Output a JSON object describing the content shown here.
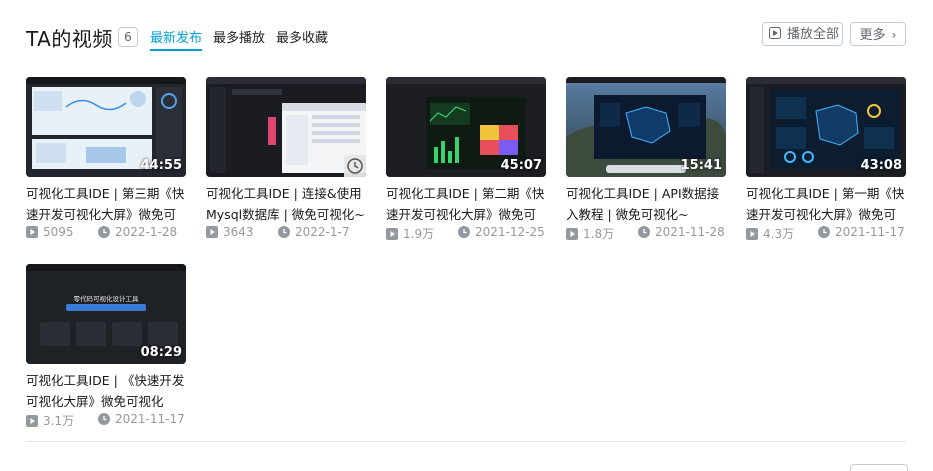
{
  "section": {
    "title": "TA的视频",
    "count": "6",
    "tabs": [
      {
        "label": "最新发布"
      },
      {
        "label": "最多播放"
      },
      {
        "label": "最多收藏"
      }
    ],
    "play_all_label": "播放全部",
    "more_label": "更多"
  },
  "videos": [
    {
      "title": "可视化工具IDE | 第三期《快速开发可视化大屏》微免可视",
      "duration": "44:55",
      "plays": "5095",
      "date": "2022-1-28"
    },
    {
      "title": "可视化工具IDE | 连接&使用Mysql数据库 | 微免可视化~",
      "duration": "",
      "plays": "3643",
      "date": "2022-1-7"
    },
    {
      "title": "可视化工具IDE | 第二期《快速开发可视化大屏》微免可视",
      "duration": "45:07",
      "plays": "1.9万",
      "date": "2021-12-25"
    },
    {
      "title": "可视化工具IDE | API数据接入教程 | 微免可视化~",
      "duration": "15:41",
      "plays": "1.8万",
      "date": "2021-11-28"
    },
    {
      "title": "可视化工具IDE | 第一期《快速开发可视化大屏》微免可视",
      "duration": "43:08",
      "plays": "4.3万",
      "date": "2021-11-17"
    },
    {
      "title": "可视化工具IDE | 《快速开发可视化大屏》微免可视化",
      "duration": "08:29",
      "plays": "3.1万",
      "date": "2021-11-17",
      "thumb_text": "零代码可视化设计工具"
    }
  ],
  "colors": {
    "accent": "#00a1d6",
    "meta": "#9499a0"
  }
}
